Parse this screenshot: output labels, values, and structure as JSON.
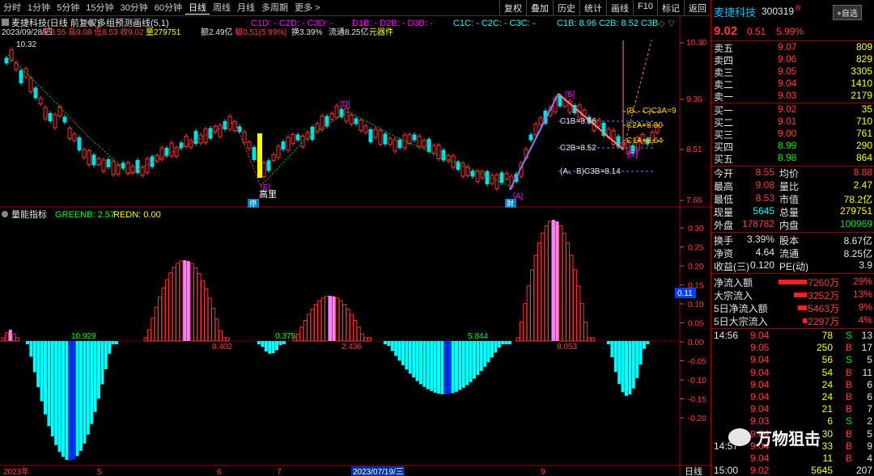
{
  "toolbar": {
    "periods": [
      "分时",
      "1分钟",
      "5分钟",
      "15分钟",
      "30分钟",
      "60分钟",
      "日线",
      "周线",
      "月线",
      "多周期",
      "更多 >"
    ],
    "active": "日线",
    "buttons": [
      "复权",
      "叠加",
      "历史",
      "统计",
      "画线",
      "F10",
      "标记",
      "返回"
    ]
  },
  "chart_header": {
    "title": "麦捷科技(日线 前复权)",
    "indicator": "多组预测画线(5,1)",
    "c1": "C1D: -  C2D: -  C3D: -",
    "d": "D1B: -  D2B: -  D3B: -",
    "c1c": "C1C: -  C2C: -  C3C: -",
    "cb": "C1B: 8.96  C2B: 8.52  C3B",
    "info_date": "2023/09/28/四",
    "info_open": "开8.55",
    "info_high": "高9.08",
    "info_low": "低8.53",
    "info_close": "收9.02",
    "info_vol": "量279751",
    "info_amt": "额2.49亿",
    "info_chg": "幅0.51(5.99%)",
    "info_turn": "换3.39%",
    "info_float": "流通8.25亿",
    "info_sector": "元器件"
  },
  "price_axis": [
    "10.30",
    "9.36",
    "8.51",
    "7.66"
  ],
  "chart_labels": {
    "high_mark": "10.32",
    "d_mark": "[D]",
    "e_mark": "[E]",
    "b_mark": "[B]",
    "c_mark": "[C]",
    "a_mark": "[A]",
    "gaoli": "高里",
    "c1b": "C1B=8.96",
    "c2b": "C2B=8.52",
    "c3b": "(A、B)C3B=8.14",
    "c3a": "(B、C)C3A=9",
    "c2a": "C2A=8.80",
    "c1a": "C1A=8.64",
    "cai1": "财",
    "cai2": "财",
    "ting": "停"
  },
  "indicator": {
    "name": "量能指标",
    "green_label": "GREENB: 2.57",
    "red_label": "REDN: 0.00",
    "values": [
      "10.929",
      "8.402",
      "0.379",
      "2.436",
      "5.844",
      "8.053"
    ],
    "axis": [
      "0.30",
      "0.25",
      "0.20",
      "0.15",
      "0.10",
      "0.05",
      "0.00",
      "-0.05",
      "-0.10",
      "-0.15",
      "-0.20"
    ],
    "current_value": "0.11"
  },
  "date_axis": [
    "2023年",
    "5",
    "6",
    "7",
    "2023/07/19/三",
    "9"
  ],
  "period_label": "日线",
  "stock": {
    "name": "麦捷科技",
    "code": "300319",
    "flag": "R",
    "select_button": "+自选",
    "price": "9.02",
    "change": "0.51",
    "change_pct": "5.99%",
    "asks": [
      {
        "label": "卖五",
        "price": "9.07",
        "vol": "809"
      },
      {
        "label": "卖四",
        "price": "9.06",
        "vol": "829"
      },
      {
        "label": "卖三",
        "price": "9.05",
        "vol": "3305"
      },
      {
        "label": "卖二",
        "price": "9.04",
        "vol": "1410"
      },
      {
        "label": "卖一",
        "price": "9.03",
        "vol": "2179"
      }
    ],
    "bids": [
      {
        "label": "买一",
        "price": "9.02",
        "vol": "35"
      },
      {
        "label": "买二",
        "price": "9.01",
        "vol": "710"
      },
      {
        "label": "买三",
        "price": "9.00",
        "vol": "761"
      },
      {
        "label": "买四",
        "price": "8.99",
        "vol": "290"
      },
      {
        "label": "买五",
        "price": "8.98",
        "vol": "864"
      }
    ],
    "stats": [
      {
        "l1": "今开",
        "v1": "8.55",
        "l2": "均价",
        "v2": "8.88"
      },
      {
        "l1": "最高",
        "v1": "9.08",
        "l2": "量比",
        "v2": "2.47"
      },
      {
        "l1": "最低",
        "v1": "8.53",
        "l2": "市值",
        "v2": "78.2亿"
      },
      {
        "l1": "现量",
        "v1": "5645",
        "l2": "总量",
        "v2": "279751"
      },
      {
        "l1": "外盘",
        "v1": "178782",
        "l2": "内盘",
        "v2": "100969"
      }
    ],
    "stats2": [
      {
        "l1": "换手",
        "v1": "3.39%",
        "l2": "股本",
        "v2": "8.67亿"
      },
      {
        "l1": "净资",
        "v1": "4.64",
        "l2": "流通",
        "v2": "8.25亿"
      },
      {
        "l1": "收益(三)",
        "v1": "0.120",
        "l2": "PE(动)",
        "v2": "3.9"
      }
    ],
    "flows": [
      {
        "label": "净流入额",
        "value": "7260万",
        "pct": "29%"
      },
      {
        "label": "大宗流入",
        "value": "3252万",
        "pct": "13%"
      },
      {
        "label": "5日净流入额",
        "value": "5463万",
        "pct": "9%"
      },
      {
        "label": "5日大宗流入",
        "value": "2297万",
        "pct": "4%"
      }
    ],
    "ticks": [
      {
        "time": "14:56",
        "price": "9.04",
        "vol": "78",
        "side": "S",
        "n": "13"
      },
      {
        "time": "",
        "price": "9.05",
        "vol": "250",
        "side": "B",
        "n": "17"
      },
      {
        "time": "",
        "price": "9.04",
        "vol": "56",
        "side": "S",
        "n": "5"
      },
      {
        "time": "",
        "price": "9.04",
        "vol": "54",
        "side": "B",
        "n": "11"
      },
      {
        "time": "",
        "price": "9.04",
        "vol": "24",
        "side": "B",
        "n": "6"
      },
      {
        "time": "",
        "price": "9.04",
        "vol": "24",
        "side": "B",
        "n": "6"
      },
      {
        "time": "",
        "price": "9.04",
        "vol": "21",
        "side": "B",
        "n": "7"
      },
      {
        "time": "",
        "price": "9.03",
        "vol": "6",
        "side": "S",
        "n": "2"
      },
      {
        "time": "",
        "price": "9.04",
        "vol": "30",
        "side": "B",
        "n": "5"
      },
      {
        "time": "14:57",
        "price": "9.04",
        "vol": "33",
        "side": "B",
        "n": "9"
      },
      {
        "time": "",
        "price": "9.04",
        "vol": "11",
        "side": "B",
        "n": "4"
      },
      {
        "time": "15:00",
        "price": "9.02",
        "vol": "5645",
        "side": "",
        "n": "207"
      }
    ]
  },
  "watermark": "万物狙击"
}
